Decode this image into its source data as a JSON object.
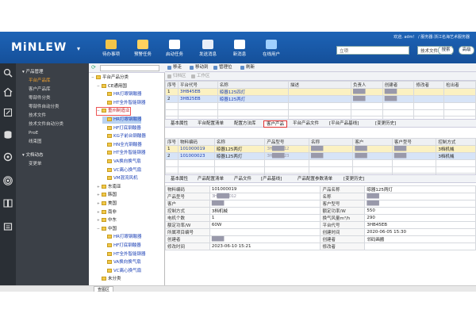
{
  "app": {
    "logo": "MiNLEW",
    "welcome": "欢迎, adm！ / 服务器:浙江名海艺术服务器"
  },
  "nav": [
    {
      "label": "待办事项",
      "icon": "todo-icon"
    },
    {
      "label": "预警任务",
      "icon": "warning-task-icon"
    },
    {
      "label": "启动任务",
      "icon": "start-task-icon"
    },
    {
      "label": "发送消息",
      "icon": "send-message-icon"
    },
    {
      "label": "新消息",
      "icon": "new-message-icon"
    },
    {
      "label": "在线用户",
      "icon": "online-user-icon"
    }
  ],
  "header_search": {
    "value": "立项",
    "select": "技术文件",
    "search_btn": "搜索",
    "adv_btn": "高级"
  },
  "sidebar_menu": [
    {
      "label": "产品管理",
      "type": "grp"
    },
    {
      "label": "平台产品库",
      "type": "sub",
      "active": true
    },
    {
      "label": "客户产品库",
      "type": "sub"
    },
    {
      "label": "零部件分类",
      "type": "sub"
    },
    {
      "label": "零部件自动分类",
      "type": "sub"
    },
    {
      "label": "技术文件",
      "type": "sub"
    },
    {
      "label": "技术文件自动分类",
      "type": "sub"
    },
    {
      "label": "ProE",
      "type": "sub"
    },
    {
      "label": "线束图",
      "type": "sub"
    },
    {
      "label": "文档动态",
      "type": "grp"
    },
    {
      "label": "变更单",
      "type": "sub"
    }
  ],
  "product_tree": [
    {
      "label": "平台产品分类",
      "level": 0,
      "exp": "−"
    },
    {
      "label": "CE通用国",
      "level": 1,
      "exp": "−"
    },
    {
      "label": "HR打眼钢酸器",
      "level": 2,
      "exp": ""
    },
    {
      "label": "HT全外智能钢器",
      "level": 2,
      "exp": ""
    },
    {
      "label": "重州制造业",
      "level": 1,
      "exp": "−",
      "red": true
    },
    {
      "label": "HR打眼钢酸器",
      "level": 2,
      "exp": "",
      "sel": true
    },
    {
      "label": "HF打底钢酸器",
      "level": 2,
      "exp": ""
    },
    {
      "label": "KG子前台钢酸器",
      "level": 2,
      "exp": ""
    },
    {
      "label": "HN全光钢酸器",
      "level": 2,
      "exp": ""
    },
    {
      "label": "HT全外智能钢器",
      "level": 2,
      "exp": ""
    },
    {
      "label": "VA换向换气扇",
      "level": 2,
      "exp": ""
    },
    {
      "label": "VC离心换气扇",
      "level": 2,
      "exp": ""
    },
    {
      "label": "VM混流风机",
      "level": 2,
      "exp": ""
    },
    {
      "label": "东南亚",
      "level": 1,
      "exp": "+"
    },
    {
      "label": "韩国",
      "level": 1,
      "exp": "+"
    },
    {
      "label": "美国",
      "level": 1,
      "exp": "+"
    },
    {
      "label": "南非",
      "level": 1,
      "exp": "+"
    },
    {
      "label": "中东",
      "level": 1,
      "exp": "+"
    },
    {
      "label": "中国",
      "level": 1,
      "exp": "−"
    },
    {
      "label": "HR打眼钢酸器",
      "level": 2,
      "exp": ""
    },
    {
      "label": "HF打底钢酸器",
      "level": 2,
      "exp": ""
    },
    {
      "label": "HT全外智能钢器",
      "level": 2,
      "exp": ""
    },
    {
      "label": "VA换向换气扇",
      "level": 2,
      "exp": ""
    },
    {
      "label": "VC离心换气扇",
      "level": 2,
      "exp": ""
    },
    {
      "label": "未分类",
      "level": 1,
      "exp": ""
    }
  ],
  "toolbar": [
    {
      "label": "移走",
      "dis": false
    },
    {
      "label": "移动到",
      "dis": false
    },
    {
      "label": "管理位",
      "dis": false
    },
    {
      "label": "刷新",
      "dis": false
    }
  ],
  "toolbar2": [
    {
      "label": "归档区"
    },
    {
      "label": "工作区"
    }
  ],
  "table1": {
    "headers": [
      "序号",
      "平台代号",
      "名称",
      "描述",
      "负责人",
      "创建者",
      "修改者",
      "检出者"
    ],
    "rows": [
      [
        "1",
        "3HB45EB",
        "晾器125四灯",
        "",
        "████",
        "████",
        "",
        ""
      ],
      [
        "2",
        "3HB25EB",
        "晾器125两灯",
        "",
        "████",
        "████",
        "",
        ""
      ]
    ]
  },
  "tabs1": [
    "基本属性",
    "平台配置清单",
    "配置方法库",
    "客户产品",
    "平台产品文件",
    "[平台产品基线]",
    "[变更历史]"
  ],
  "table2": {
    "headers": [
      "序号",
      "物料编码",
      "名称",
      "产品型号",
      "名称",
      "客户",
      "客户型号",
      "控制方式"
    ],
    "rows": [
      [
        "1",
        "101000019",
        "晾器125两灯",
        "3H████12",
        "████",
        "████",
        "████",
        "3档机械"
      ],
      [
        "2",
        "101000023",
        "晾器125两灯",
        "3H████23",
        "████",
        "████",
        "████",
        "3档机械"
      ]
    ]
  },
  "tabs2": [
    "基本属性",
    "产品配置清单",
    "产品文件",
    "[产品基线]",
    "产品配置参数清单",
    "[变更历史]"
  ],
  "detail": [
    [
      "物料编码",
      "101000019",
      "产品名称",
      "晾器125两灯"
    ],
    [
      "产品型号",
      "3H████012",
      "名称",
      "████"
    ],
    [
      "客户",
      "████",
      "客户型号",
      "████"
    ],
    [
      "控制方式",
      "3档机械",
      "额定功率/W",
      "550"
    ],
    [
      "电机个数",
      "1",
      "换气风量m³/h",
      "290"
    ],
    [
      "额定功率/W",
      "60W",
      "平台代号",
      "3HB45EB"
    ],
    [
      "所属项目编号",
      "",
      "创建时间",
      "2020-06-05 15:30"
    ],
    [
      "创建者",
      "████",
      "创建者",
      "邻码画搬"
    ],
    [
      "修改时间",
      "2023-06-10 15:21",
      "修改者",
      ""
    ]
  ],
  "statusbar": {
    "tab": "查图区"
  }
}
